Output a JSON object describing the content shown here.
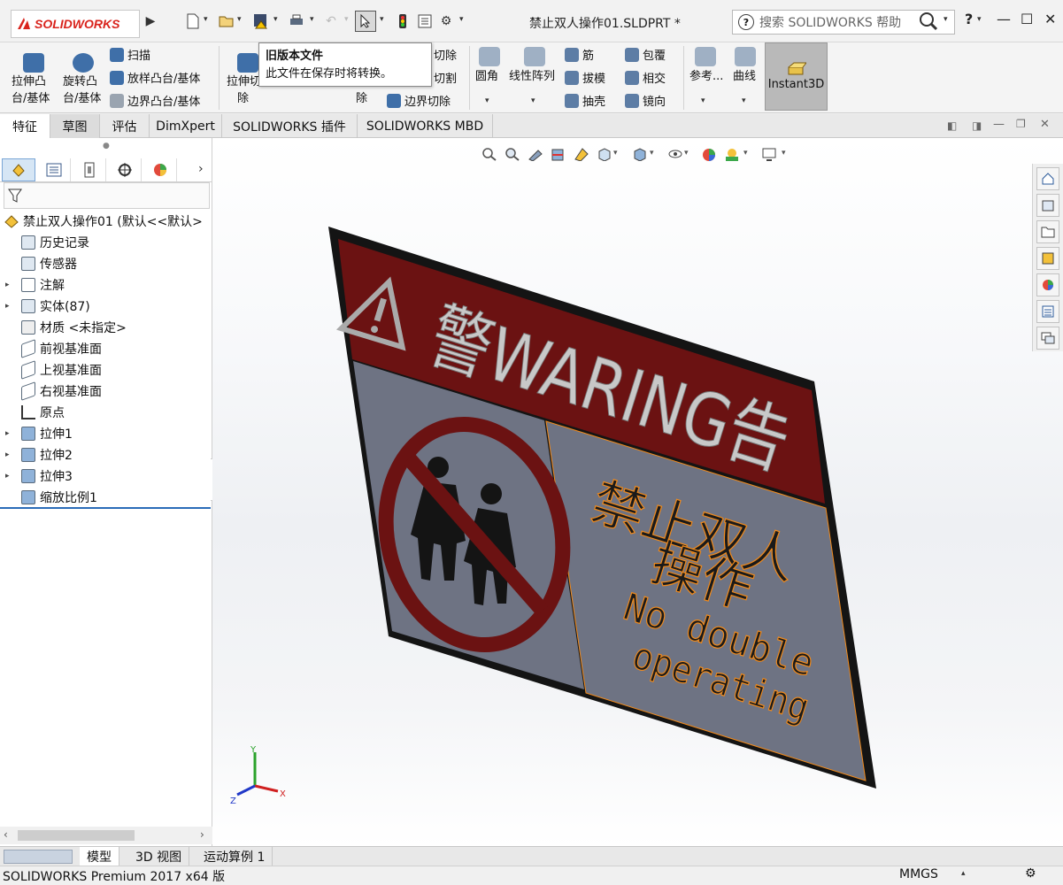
{
  "app": {
    "logo_text": "SOLIDWORKS",
    "doc_title": "禁止双人操作01.SLDPRT *",
    "search_placeholder": "搜索 SOLIDWORKS 帮助",
    "help_label": "?",
    "brand_color": "#d9231c"
  },
  "tooltip": {
    "title": "旧版本文件",
    "body": "此文件在保存时将转换。"
  },
  "ribbon": {
    "extrude_boss": "拉伸凸台/基体",
    "extrude_boss_l1": "拉伸凸",
    "extrude_boss_l2": "台/基体",
    "revolve_boss_l1": "旋转凸",
    "revolve_boss_l2": "台/基体",
    "sweep": "扫描",
    "loft_boss": "放样凸台/基体",
    "boundary_boss": "边界凸台/基体",
    "extrude_cut_l1": "拉伸切",
    "extrude_cut_l2": "除",
    "cut_partial1": "切除",
    "cut_partial2": "切割",
    "cut_partial3": "除",
    "boundary_cut": "边界切除",
    "fillet": "圆角",
    "linear_pattern": "线性阵列",
    "rib": "筋",
    "draft": "拔模",
    "shell": "抽壳",
    "wrap": "包覆",
    "intersect": "相交",
    "mirror": "镜向",
    "reference": "参考...",
    "curves": "曲线",
    "instant3d": "Instant3D"
  },
  "tabs": [
    "特征",
    "草图",
    "评估",
    "DimXpert",
    "SOLIDWORKS 插件",
    "SOLIDWORKS MBD"
  ],
  "tree": {
    "root": "禁止双人操作01  (默认<<默认>",
    "items": [
      {
        "label": "历史记录",
        "arrow": ""
      },
      {
        "label": "传感器",
        "arrow": ""
      },
      {
        "label": "注解",
        "arrow": "▸"
      },
      {
        "label": "实体(87)",
        "arrow": "▸"
      },
      {
        "label": "材质 <未指定>",
        "arrow": ""
      },
      {
        "label": "前视基准面",
        "arrow": ""
      },
      {
        "label": "上视基准面",
        "arrow": ""
      },
      {
        "label": "右视基准面",
        "arrow": ""
      },
      {
        "label": "原点",
        "arrow": ""
      },
      {
        "label": "拉伸1",
        "arrow": "▸"
      },
      {
        "label": "拉伸2",
        "arrow": "▸"
      },
      {
        "label": "拉伸3",
        "arrow": "▸"
      },
      {
        "label": "缩放比例1",
        "arrow": ""
      }
    ]
  },
  "bottom_tabs": [
    "模型",
    "3D 视图",
    "运动算例 1"
  ],
  "status": {
    "left": "SOLIDWORKS Premium 2017 x64 版",
    "units": "MMGS"
  },
  "sign": {
    "banner": "警WARING告",
    "cn_line1": "禁止双人",
    "cn_line2": "操作",
    "en_line1": "No double",
    "en_line2": "operating",
    "banner_color": "#6b1212",
    "panel_color": "#6e7383",
    "text_color": "#f08a1c",
    "frame_color": "#141414"
  },
  "triad": {
    "x": "X",
    "y": "Y",
    "z": "Z"
  }
}
